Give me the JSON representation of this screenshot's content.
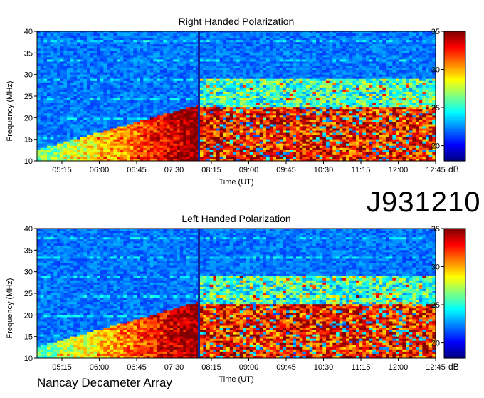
{
  "identifier": "J931210",
  "footer": "Nancay Decameter Array",
  "chart_data": [
    {
      "type": "heatmap",
      "title": "Right Handed Polarization",
      "xlabel": "Time (UT)",
      "ylabel": "Frequency (MHz)",
      "x_ticks": [
        "05:15",
        "06:00",
        "06:45",
        "07:30",
        "08:15",
        "09:00",
        "09:45",
        "10:30",
        "11:15",
        "12:00",
        "12:45"
      ],
      "y_ticks": [
        "10",
        "15",
        "20",
        "25",
        "30",
        "35",
        "40"
      ],
      "ylim": [
        10,
        40
      ],
      "xlim_hours": [
        4.75,
        12.75
      ],
      "colorbar": {
        "label": "dB",
        "ticks": [
          "20",
          "25",
          "30",
          "35"
        ],
        "range": [
          18,
          35
        ]
      },
      "gap_time": "08:00"
    },
    {
      "type": "heatmap",
      "title": "Left Handed Polarization",
      "xlabel": "Time (UT)",
      "ylabel": "Frequency (MHz)",
      "x_ticks": [
        "05:15",
        "06:00",
        "06:45",
        "07:30",
        "08:15",
        "09:00",
        "09:45",
        "10:30",
        "11:15",
        "12:00",
        "12:45"
      ],
      "y_ticks": [
        "10",
        "15",
        "20",
        "25",
        "30",
        "35",
        "40"
      ],
      "ylim": [
        10,
        40
      ],
      "xlim_hours": [
        4.75,
        12.75
      ],
      "colorbar": {
        "label": "dB",
        "ticks": [
          "20",
          "25",
          "30",
          "35"
        ],
        "range": [
          18,
          35
        ]
      },
      "gap_time": "08:00"
    }
  ]
}
